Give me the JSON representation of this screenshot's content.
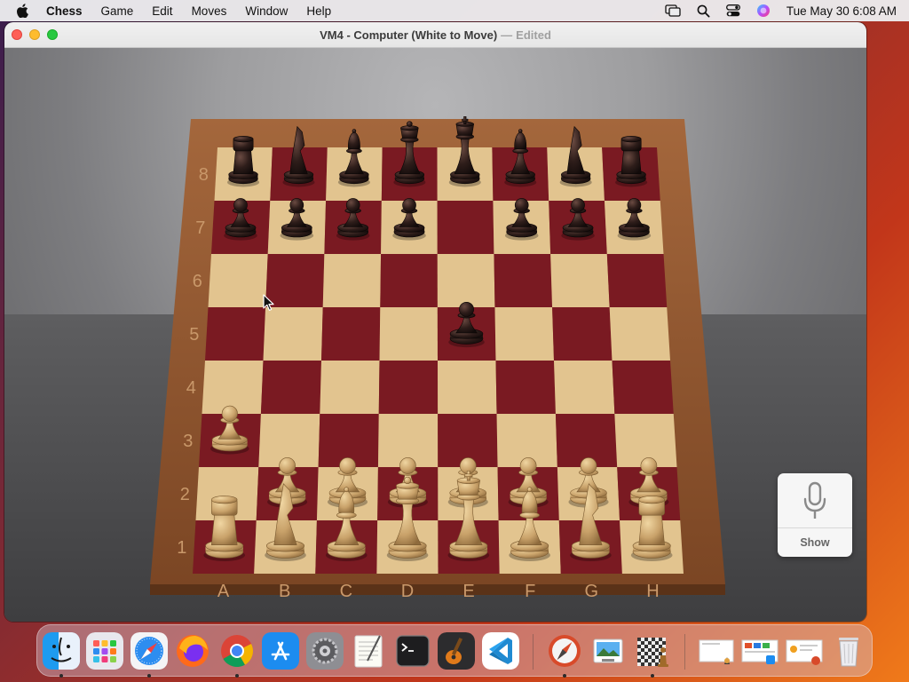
{
  "menubar": {
    "app_name": "Chess",
    "items": [
      "Game",
      "Edit",
      "Moves",
      "Window",
      "Help"
    ],
    "clock": "Tue May 30  6:08 AM",
    "status_icons": [
      "screen-mirroring-icon",
      "search-icon",
      "control-center-icon",
      "siri-icon"
    ]
  },
  "window": {
    "title": "VM4 - Computer   (White to Move)",
    "separator": "—",
    "edited": "Edited"
  },
  "board": {
    "rank_labels": [
      "8",
      "7",
      "6",
      "5",
      "4",
      "3",
      "2",
      "1"
    ],
    "file_labels": [
      "A",
      "B",
      "C",
      "D",
      "E",
      "F",
      "G",
      "H"
    ],
    "colors": {
      "light_square": "#e2c48f",
      "dark_square": "#7a1a22",
      "frame": "#8a5230",
      "white_piece": "#c9a26a",
      "black_piece": "#2a1a17"
    },
    "pieces": [
      {
        "square": "a8",
        "type": "rook",
        "color": "black"
      },
      {
        "square": "b8",
        "type": "knight",
        "color": "black"
      },
      {
        "square": "c8",
        "type": "bishop",
        "color": "black"
      },
      {
        "square": "d8",
        "type": "queen",
        "color": "black"
      },
      {
        "square": "e8",
        "type": "king",
        "color": "black"
      },
      {
        "square": "f8",
        "type": "bishop",
        "color": "black"
      },
      {
        "square": "g8",
        "type": "knight",
        "color": "black"
      },
      {
        "square": "h8",
        "type": "rook",
        "color": "black"
      },
      {
        "square": "a7",
        "type": "pawn",
        "color": "black"
      },
      {
        "square": "b7",
        "type": "pawn",
        "color": "black"
      },
      {
        "square": "c7",
        "type": "pawn",
        "color": "black"
      },
      {
        "square": "d7",
        "type": "pawn",
        "color": "black"
      },
      {
        "square": "f7",
        "type": "pawn",
        "color": "black"
      },
      {
        "square": "g7",
        "type": "pawn",
        "color": "black"
      },
      {
        "square": "h7",
        "type": "pawn",
        "color": "black"
      },
      {
        "square": "e5",
        "type": "pawn",
        "color": "black"
      },
      {
        "square": "a3",
        "type": "pawn",
        "color": "white"
      },
      {
        "square": "b2",
        "type": "pawn",
        "color": "white"
      },
      {
        "square": "c2",
        "type": "pawn",
        "color": "white"
      },
      {
        "square": "d2",
        "type": "pawn",
        "color": "white"
      },
      {
        "square": "e2",
        "type": "pawn",
        "color": "white"
      },
      {
        "square": "f2",
        "type": "pawn",
        "color": "white"
      },
      {
        "square": "g2",
        "type": "pawn",
        "color": "white"
      },
      {
        "square": "h2",
        "type": "pawn",
        "color": "white"
      },
      {
        "square": "a1",
        "type": "rook",
        "color": "white"
      },
      {
        "square": "b1",
        "type": "knight",
        "color": "white"
      },
      {
        "square": "c1",
        "type": "bishop",
        "color": "white"
      },
      {
        "square": "d1",
        "type": "queen",
        "color": "white"
      },
      {
        "square": "e1",
        "type": "king",
        "color": "white"
      },
      {
        "square": "f1",
        "type": "bishop",
        "color": "white"
      },
      {
        "square": "g1",
        "type": "knight",
        "color": "white"
      },
      {
        "square": "h1",
        "type": "rook",
        "color": "white"
      }
    ]
  },
  "dictation": {
    "icon": "microphone-icon",
    "label": "Show"
  },
  "dock": {
    "apps": [
      {
        "name": "finder",
        "icon": "finder-icon",
        "running": true
      },
      {
        "name": "launchpad",
        "icon": "launchpad-icon",
        "running": false
      },
      {
        "name": "safari",
        "icon": "safari-icon",
        "running": true
      },
      {
        "name": "firefox",
        "icon": "firefox-icon",
        "running": false
      },
      {
        "name": "chrome",
        "icon": "chrome-icon",
        "running": true
      },
      {
        "name": "app-store",
        "icon": "app-store-icon",
        "running": false
      },
      {
        "name": "system-settings",
        "icon": "system-settings-icon",
        "running": false
      },
      {
        "name": "textedit",
        "icon": "textedit-icon",
        "running": false
      },
      {
        "name": "terminal",
        "icon": "terminal-icon",
        "running": false
      },
      {
        "name": "garageband",
        "icon": "garageband-icon",
        "running": false
      },
      {
        "name": "vscode",
        "icon": "vscode-icon",
        "running": false
      },
      {
        "name": "compass",
        "icon": "compass-icon",
        "running": true
      },
      {
        "name": "preview",
        "icon": "preview-icon",
        "running": false
      },
      {
        "name": "chess",
        "icon": "chess-icon",
        "running": true
      },
      {
        "name": "recent-1",
        "icon": "document-thumbnail-icon",
        "running": false
      },
      {
        "name": "recent-2",
        "icon": "document-thumbnail-icon",
        "running": false
      },
      {
        "name": "recent-3",
        "icon": "document-thumbnail-icon",
        "running": false
      },
      {
        "name": "trash",
        "icon": "trash-icon",
        "running": false
      }
    ]
  }
}
